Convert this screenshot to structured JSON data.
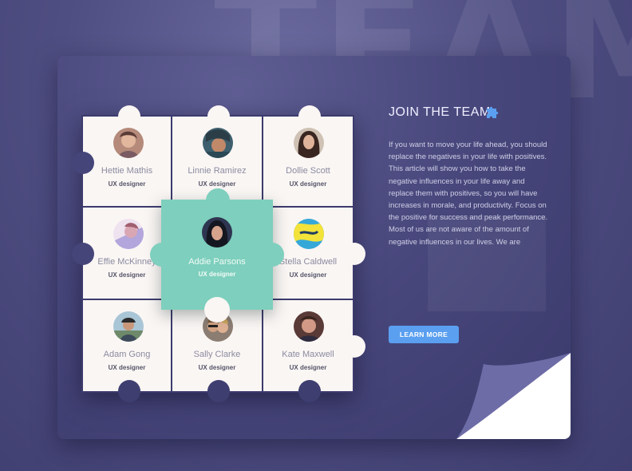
{
  "background_word": "TEAM",
  "join": {
    "title": "JOIN THE TEAM",
    "body": "If you want to move your life ahead, you should replace the negatives in your life with positives. This article will show you how to take the negative influences in your life away and replace them with positives, so you will have increases in morale, and productivity. Focus on the positive for success and peak performance. Most of us are not aware of the amount of negative influences in our lives. We are",
    "button_label": "LEARN MORE",
    "icon": "puzzle-icon"
  },
  "colors": {
    "accent_teal": "#7ecfbd",
    "button_blue": "#5a9ff0",
    "card_bg": "#48477c",
    "piece_bg": "#faf6f4"
  },
  "team": [
    {
      "name": "Hettie Mathis",
      "role": "UX designer"
    },
    {
      "name": "Linnie Ramirez",
      "role": "UX designer"
    },
    {
      "name": "Dollie Scott",
      "role": "UX designer"
    },
    {
      "name": "Effie McKinney",
      "role": "UX designer"
    },
    {
      "name": "Addie Parsons",
      "role": "UX designer",
      "featured": true
    },
    {
      "name": "Stella Caldwell",
      "role": "UX designer"
    },
    {
      "name": "Adam Gong",
      "role": "UX designer"
    },
    {
      "name": "Sally Clarke",
      "role": "UX designer"
    },
    {
      "name": "Kate Maxwell",
      "role": "UX designer"
    }
  ]
}
